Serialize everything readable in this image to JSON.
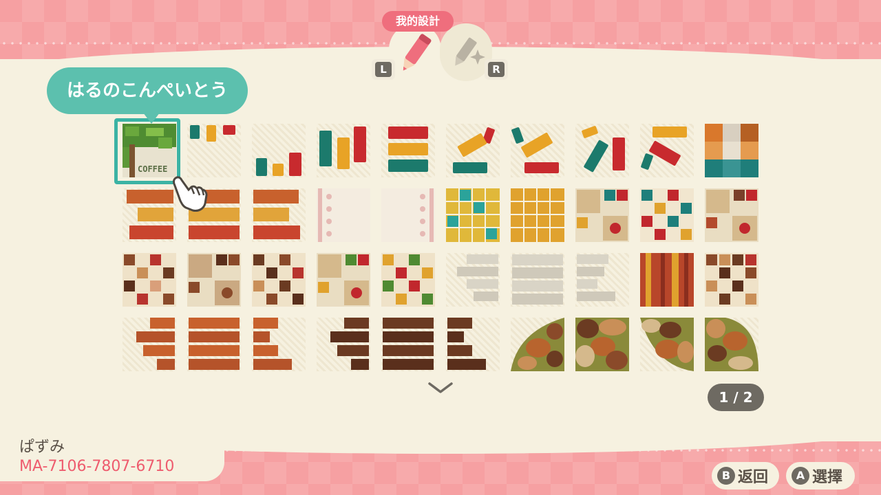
{
  "header": {
    "title": "我的設計",
    "left_shoulder": "L",
    "right_shoulder": "R"
  },
  "selected_design": {
    "name": "はるのこんぺいとう",
    "thumbnail_text": "COFFEE"
  },
  "pagination": {
    "label": "1 / 2"
  },
  "player": {
    "name": "ぱずみ",
    "code": "MA-7106-7807-6710"
  },
  "controls": {
    "back": {
      "key": "B",
      "label": "返回"
    },
    "select": {
      "key": "A",
      "label": "選擇"
    }
  },
  "colors": {
    "accent_teal": "#5cc0ae",
    "accent_pink": "#ef6e7d",
    "code_pink": "#ee5c6e",
    "panel": "#f6f1e0",
    "dark_badge": "#6e6a62"
  },
  "icons": {
    "active_tab": "pencil-icon",
    "inactive_tab": "sparkle-pencil-icon",
    "cursor": "pointing-hand-icon",
    "more": "chevron-down-icon"
  }
}
